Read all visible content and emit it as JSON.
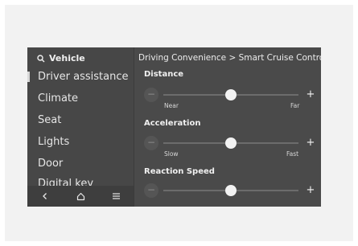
{
  "search": {
    "label": "Vehicle",
    "icon": "search-icon"
  },
  "sidebar": {
    "items": [
      {
        "label": "Driver assistance",
        "active": true
      },
      {
        "label": "Climate"
      },
      {
        "label": "Seat"
      },
      {
        "label": "Lights"
      },
      {
        "label": "Door"
      },
      {
        "label": "Digital key"
      }
    ],
    "bottom_icons": [
      "back-icon",
      "home-icon",
      "menu-icon"
    ]
  },
  "breadcrumb": {
    "text": "Driving Convenience > Smart Cruise Control"
  },
  "settings": [
    {
      "title": "Distance",
      "min_label": "Near",
      "max_label": "Far",
      "value": 0.5
    },
    {
      "title": "Acceleration",
      "min_label": "Slow",
      "max_label": "Fast",
      "value": 0.5
    },
    {
      "title": "Reaction Speed",
      "min_label": "",
      "max_label": "",
      "value": 0.5
    }
  ],
  "colors": {
    "screen_bg": "#4a4a4a",
    "thumb": "#f2f2f2",
    "text": "#eaeaea"
  }
}
